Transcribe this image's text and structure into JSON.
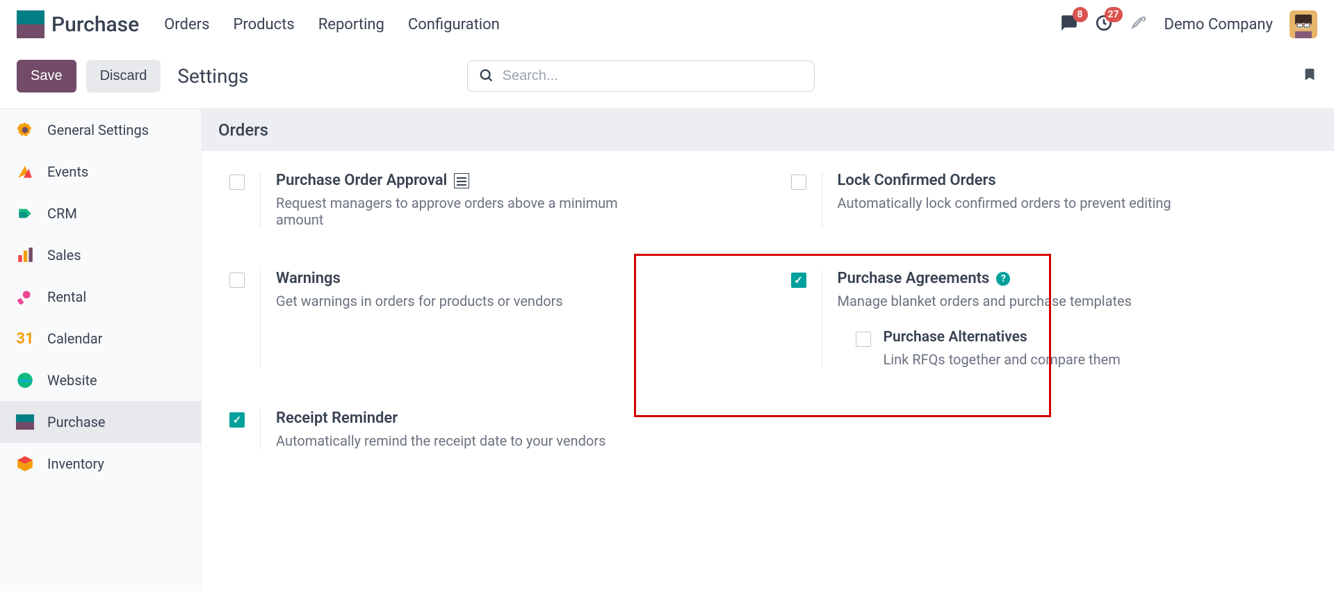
{
  "topnav": {
    "app_title": "Purchase",
    "menu": [
      "Orders",
      "Products",
      "Reporting",
      "Configuration"
    ],
    "messages_badge": "8",
    "activities_badge": "27",
    "company": "Demo Company"
  },
  "actions": {
    "save": "Save",
    "discard": "Discard",
    "page_title": "Settings",
    "search_placeholder": "Search..."
  },
  "sidebar": {
    "items": [
      {
        "label": "General Settings"
      },
      {
        "label": "Events"
      },
      {
        "label": "CRM"
      },
      {
        "label": "Sales"
      },
      {
        "label": "Rental"
      },
      {
        "label": "Calendar"
      },
      {
        "label": "Website"
      },
      {
        "label": "Purchase"
      },
      {
        "label": "Inventory"
      }
    ]
  },
  "section": {
    "title": "Orders"
  },
  "settings": {
    "po_approval": {
      "title": "Purchase Order Approval",
      "desc": "Request managers to approve orders above a minimum amount",
      "checked": false
    },
    "lock_confirmed": {
      "title": "Lock Confirmed Orders",
      "desc": "Automatically lock confirmed orders to prevent editing",
      "checked": false
    },
    "warnings": {
      "title": "Warnings",
      "desc": "Get warnings in orders for products or vendors",
      "checked": false
    },
    "agreements": {
      "title": "Purchase Agreements",
      "desc": "Manage blanket orders and purchase templates",
      "checked": true,
      "sub": {
        "title": "Purchase Alternatives",
        "desc": "Link RFQs together and compare them",
        "checked": false
      }
    },
    "receipt_reminder": {
      "title": "Receipt Reminder",
      "desc": "Automatically remind the receipt date to your vendors",
      "checked": true
    }
  }
}
